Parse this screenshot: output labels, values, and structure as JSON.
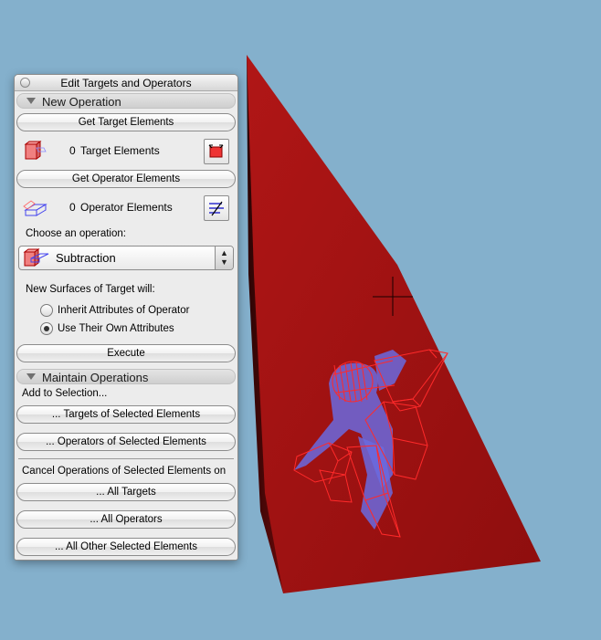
{
  "window": {
    "title": "Edit Targets and Operators"
  },
  "new_operation": {
    "header": "New Operation",
    "get_target_button": "Get Target Elements",
    "target_count": "0",
    "target_label": "Target Elements",
    "get_operator_button": "Get Operator Elements",
    "operator_count": "0",
    "operator_label": "Operator Elements",
    "choose_label": "Choose an operation:",
    "operation_selected": "Subtraction",
    "surfaces_label": "New Surfaces of Target will:",
    "radio_options": [
      {
        "label": "Inherit Attributes of Operator",
        "checked": false
      },
      {
        "label": "Use Their Own Attributes",
        "checked": true
      }
    ],
    "execute_button": "Execute"
  },
  "maintain_operations": {
    "header": "Maintain Operations",
    "add_label": "Add to Selection...",
    "targets_button": "... Targets of Selected Elements",
    "operators_button": "... Operators of Selected Elements",
    "cancel_label": "Cancel Operations of Selected Elements on",
    "all_targets_button": "... All Targets",
    "all_operators_button": "... All Operators",
    "all_other_button": "... All Other Selected Elements"
  },
  "colors": {
    "background": "#84b0cc",
    "target_red": "#a81414",
    "operator_blue": "#6a6adf",
    "wire_red": "#ff1a1a"
  },
  "icons": {
    "target_element": "target-element-icon",
    "operator_element": "operator-element-icon",
    "select_target": "select-target-icon",
    "select_operator": "select-operator-icon",
    "operation_type": "subtraction-icon",
    "crosshair": "crosshair-cursor-icon"
  }
}
